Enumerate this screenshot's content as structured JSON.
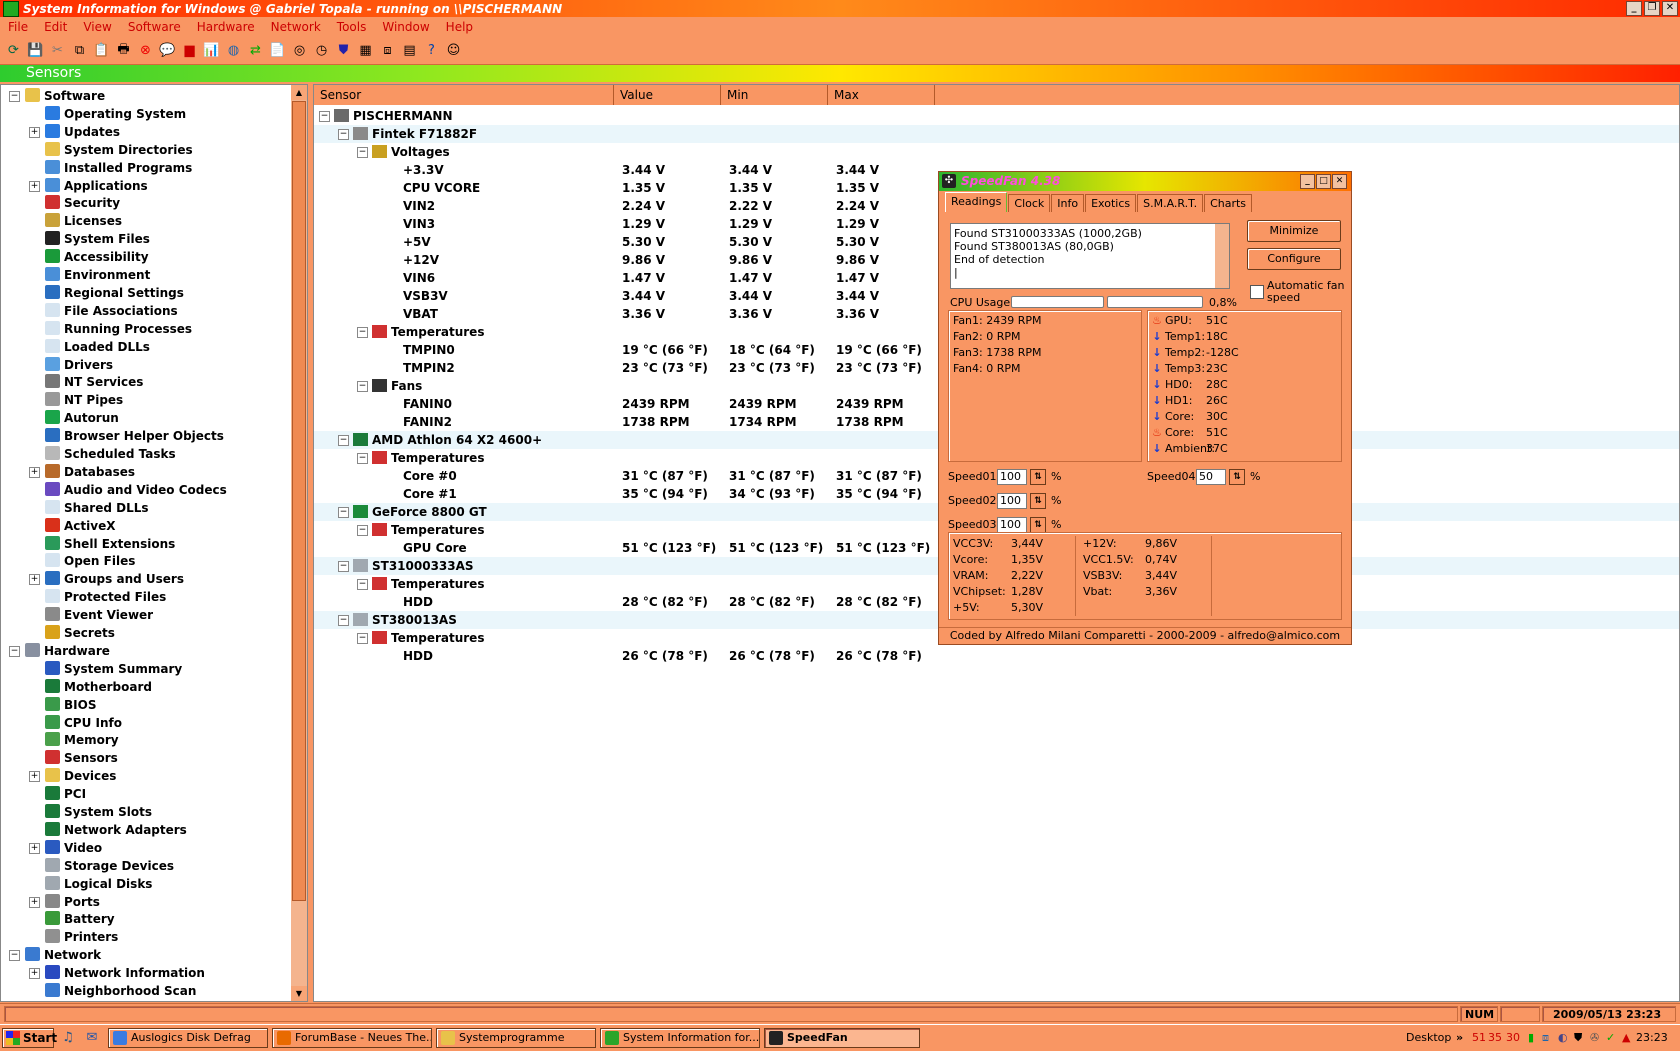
{
  "title": "System Information for Windows  @ Gabriel Topala - running on \\\\PISCHERMANN",
  "menu": [
    "File",
    "Edit",
    "View",
    "Software",
    "Hardware",
    "Network",
    "Tools",
    "Window",
    "Help"
  ],
  "section_header": "Sensors",
  "tree": [
    {
      "label": "Software",
      "level": 0,
      "pm": "−",
      "icon": "folder"
    },
    {
      "label": "Operating System",
      "level": 1,
      "pm": "",
      "icon": "windows"
    },
    {
      "label": "Updates",
      "level": 1,
      "pm": "+",
      "icon": "windows"
    },
    {
      "label": "System Directories",
      "level": 1,
      "pm": "",
      "icon": "folder"
    },
    {
      "label": "Installed Programs",
      "level": 1,
      "pm": "",
      "icon": "window"
    },
    {
      "label": "Applications",
      "level": 1,
      "pm": "+",
      "icon": "window"
    },
    {
      "label": "Security",
      "level": 1,
      "pm": "",
      "icon": "shield"
    },
    {
      "label": "Licenses",
      "level": 1,
      "pm": "",
      "icon": "lock"
    },
    {
      "label": "System Files",
      "level": 1,
      "pm": "",
      "icon": "cmd"
    },
    {
      "label": "Accessibility",
      "level": 1,
      "pm": "",
      "icon": "accessibility"
    },
    {
      "label": "Environment",
      "level": 1,
      "pm": "",
      "icon": "window"
    },
    {
      "label": "Regional Settings",
      "level": 1,
      "pm": "",
      "icon": "globe"
    },
    {
      "label": "File Associations",
      "level": 1,
      "pm": "",
      "icon": "file"
    },
    {
      "label": "Running Processes",
      "level": 1,
      "pm": "",
      "icon": "file"
    },
    {
      "label": "Loaded DLLs",
      "level": 1,
      "pm": "",
      "icon": "file"
    },
    {
      "label": "Drivers",
      "level": 1,
      "pm": "",
      "icon": "star"
    },
    {
      "label": "NT Services",
      "level": 1,
      "pm": "",
      "icon": "gears"
    },
    {
      "label": "NT Pipes",
      "level": 1,
      "pm": "",
      "icon": "pipe"
    },
    {
      "label": "Autorun",
      "level": 1,
      "pm": "",
      "icon": "autorun"
    },
    {
      "label": "Browser Helper Objects",
      "level": 1,
      "pm": "",
      "icon": "globe"
    },
    {
      "label": "Scheduled Tasks",
      "level": 1,
      "pm": "",
      "icon": "clock"
    },
    {
      "label": "Databases",
      "level": 1,
      "pm": "+",
      "icon": "database"
    },
    {
      "label": "Audio and Video Codecs",
      "level": 1,
      "pm": "",
      "icon": "music"
    },
    {
      "label": "Shared DLLs",
      "level": 1,
      "pm": "",
      "icon": "file"
    },
    {
      "label": "ActiveX",
      "level": 1,
      "pm": "",
      "icon": "activex"
    },
    {
      "label": "Shell Extensions",
      "level": 1,
      "pm": "",
      "icon": "shell"
    },
    {
      "label": "Open Files",
      "level": 1,
      "pm": "",
      "icon": "file"
    },
    {
      "label": "Groups and Users",
      "level": 1,
      "pm": "+",
      "icon": "users"
    },
    {
      "label": "Protected Files",
      "level": 1,
      "pm": "",
      "icon": "file"
    },
    {
      "label": "Event Viewer",
      "level": 1,
      "pm": "",
      "icon": "event"
    },
    {
      "label": "Secrets",
      "level": 1,
      "pm": "",
      "icon": "key"
    },
    {
      "label": "Hardware",
      "level": 0,
      "pm": "−",
      "icon": "hardware"
    },
    {
      "label": "System Summary",
      "level": 1,
      "pm": "",
      "icon": "monitor"
    },
    {
      "label": "Motherboard",
      "level": 1,
      "pm": "",
      "icon": "board"
    },
    {
      "label": "BIOS",
      "level": 1,
      "pm": "",
      "icon": "chip"
    },
    {
      "label": "CPU Info",
      "level": 1,
      "pm": "",
      "icon": "chip"
    },
    {
      "label": "Memory",
      "level": 1,
      "pm": "",
      "icon": "memory"
    },
    {
      "label": "Sensors",
      "level": 1,
      "pm": "",
      "icon": "thermo"
    },
    {
      "label": "Devices",
      "level": 1,
      "pm": "+",
      "icon": "devices"
    },
    {
      "label": "PCI",
      "level": 1,
      "pm": "",
      "icon": "board"
    },
    {
      "label": "System Slots",
      "level": 1,
      "pm": "",
      "icon": "board"
    },
    {
      "label": "Network Adapters",
      "level": 1,
      "pm": "",
      "icon": "board"
    },
    {
      "label": "Video",
      "level": 1,
      "pm": "+",
      "icon": "monitor"
    },
    {
      "label": "Storage Devices",
      "level": 1,
      "pm": "",
      "icon": "disk"
    },
    {
      "label": "Logical Disks",
      "level": 1,
      "pm": "",
      "icon": "disk"
    },
    {
      "label": "Ports",
      "level": 1,
      "pm": "+",
      "icon": "port"
    },
    {
      "label": "Battery",
      "level": 1,
      "pm": "",
      "icon": "battery"
    },
    {
      "label": "Printers",
      "level": 1,
      "pm": "",
      "icon": "printer"
    },
    {
      "label": "Network",
      "level": 0,
      "pm": "−",
      "icon": "network"
    },
    {
      "label": "Network Information",
      "level": 1,
      "pm": "+",
      "icon": "info"
    },
    {
      "label": "Neighborhood Scan",
      "level": 1,
      "pm": "",
      "icon": "network"
    }
  ],
  "sensor_columns": [
    "Sensor",
    "Value",
    "Min",
    "Max"
  ],
  "sensor_rows": [
    {
      "indent": 0,
      "label": "PISCHERMANN",
      "pm": "−",
      "icon": "computer",
      "value": "",
      "min": "",
      "max": "",
      "band": false
    },
    {
      "indent": 1,
      "label": "Fintek F71882F",
      "pm": "−",
      "icon": "chipgrey",
      "value": "",
      "min": "",
      "max": "",
      "band": true
    },
    {
      "indent": 2,
      "label": "Voltages",
      "pm": "−",
      "icon": "volt",
      "value": "",
      "min": "",
      "max": "",
      "band": false
    },
    {
      "indent": 3,
      "label": "+3.3V",
      "pm": "",
      "icon": "",
      "value": "3.44 V",
      "min": "3.44 V",
      "max": "3.44 V",
      "band": false
    },
    {
      "indent": 3,
      "label": "CPU VCORE",
      "pm": "",
      "icon": "",
      "value": "1.35 V",
      "min": "1.35 V",
      "max": "1.35 V",
      "band": false
    },
    {
      "indent": 3,
      "label": "VIN2",
      "pm": "",
      "icon": "",
      "value": "2.24 V",
      "min": "2.22 V",
      "max": "2.24 V",
      "band": false
    },
    {
      "indent": 3,
      "label": "VIN3",
      "pm": "",
      "icon": "",
      "value": "1.29 V",
      "min": "1.29 V",
      "max": "1.29 V",
      "band": false
    },
    {
      "indent": 3,
      "label": "+5V",
      "pm": "",
      "icon": "",
      "value": "5.30 V",
      "min": "5.30 V",
      "max": "5.30 V",
      "band": false
    },
    {
      "indent": 3,
      "label": "+12V",
      "pm": "",
      "icon": "",
      "value": "9.86 V",
      "min": "9.86 V",
      "max": "9.86 V",
      "band": false
    },
    {
      "indent": 3,
      "label": "VIN6",
      "pm": "",
      "icon": "",
      "value": "1.47 V",
      "min": "1.47 V",
      "max": "1.47 V",
      "band": false
    },
    {
      "indent": 3,
      "label": "VSB3V",
      "pm": "",
      "icon": "",
      "value": "3.44 V",
      "min": "3.44 V",
      "max": "3.44 V",
      "band": false
    },
    {
      "indent": 3,
      "label": "VBAT",
      "pm": "",
      "icon": "",
      "value": "3.36 V",
      "min": "3.36 V",
      "max": "3.36 V",
      "band": false
    },
    {
      "indent": 2,
      "label": "Temperatures",
      "pm": "−",
      "icon": "thermo",
      "value": "",
      "min": "",
      "max": "",
      "band": false
    },
    {
      "indent": 3,
      "label": "TMPIN0",
      "pm": "",
      "icon": "",
      "value": "19 °C (66 °F)",
      "min": "18 °C (64 °F)",
      "max": "19 °C (66 °F)",
      "band": false
    },
    {
      "indent": 3,
      "label": "TMPIN2",
      "pm": "",
      "icon": "",
      "value": "23 °C (73 °F)",
      "min": "23 °C (73 °F)",
      "max": "23 °C (73 °F)",
      "band": false
    },
    {
      "indent": 2,
      "label": "Fans",
      "pm": "−",
      "icon": "fan",
      "value": "",
      "min": "",
      "max": "",
      "band": false
    },
    {
      "indent": 3,
      "label": "FANIN0",
      "pm": "",
      "icon": "",
      "value": "2439 RPM",
      "min": "2439 RPM",
      "max": "2439 RPM",
      "band": false
    },
    {
      "indent": 3,
      "label": "FANIN2",
      "pm": "",
      "icon": "",
      "value": "1738 RPM",
      "min": "1734 RPM",
      "max": "1738 RPM",
      "band": false
    },
    {
      "indent": 1,
      "label": "AMD Athlon 64 X2 4600+",
      "pm": "−",
      "icon": "cpu",
      "value": "",
      "min": "",
      "max": "",
      "band": true
    },
    {
      "indent": 2,
      "label": "Temperatures",
      "pm": "−",
      "icon": "thermo",
      "value": "",
      "min": "",
      "max": "",
      "band": false
    },
    {
      "indent": 3,
      "label": "Core #0",
      "pm": "",
      "icon": "",
      "value": "31 °C (87 °F)",
      "min": "31 °C (87 °F)",
      "max": "31 °C (87 °F)",
      "band": false
    },
    {
      "indent": 3,
      "label": "Core #1",
      "pm": "",
      "icon": "",
      "value": "35 °C (94 °F)",
      "min": "34 °C (93 °F)",
      "max": "35 °C (94 °F)",
      "band": false
    },
    {
      "indent": 1,
      "label": "GeForce 8800 GT",
      "pm": "−",
      "icon": "gpu",
      "value": "",
      "min": "",
      "max": "",
      "band": true
    },
    {
      "indent": 2,
      "label": "Temperatures",
      "pm": "−",
      "icon": "thermo",
      "value": "",
      "min": "",
      "max": "",
      "band": false
    },
    {
      "indent": 3,
      "label": "GPU Core",
      "pm": "",
      "icon": "",
      "value": "51 °C (123 °F)",
      "min": "51 °C (123 °F)",
      "max": "51 °C (123 °F)",
      "band": false
    },
    {
      "indent": 1,
      "label": "ST31000333AS",
      "pm": "−",
      "icon": "hdd",
      "value": "",
      "min": "",
      "max": "",
      "band": true
    },
    {
      "indent": 2,
      "label": "Temperatures",
      "pm": "−",
      "icon": "thermo",
      "value": "",
      "min": "",
      "max": "",
      "band": false
    },
    {
      "indent": 3,
      "label": "HDD",
      "pm": "",
      "icon": "",
      "value": "28 °C (82 °F)",
      "min": "28 °C (82 °F)",
      "max": "28 °C (82 °F)",
      "band": false
    },
    {
      "indent": 1,
      "label": "ST380013AS",
      "pm": "−",
      "icon": "hdd",
      "value": "",
      "min": "",
      "max": "",
      "band": true
    },
    {
      "indent": 2,
      "label": "Temperatures",
      "pm": "−",
      "icon": "thermo",
      "value": "",
      "min": "",
      "max": "",
      "band": false
    },
    {
      "indent": 3,
      "label": "HDD",
      "pm": "",
      "icon": "",
      "value": "26 °C (78 °F)",
      "min": "26 °C (78 °F)",
      "max": "26 °C (78 °F)",
      "band": false
    }
  ],
  "speedfan": {
    "title": "SpeedFan 4.38",
    "tabs": [
      "Readings",
      "Clock",
      "Info",
      "Exotics",
      "S.M.A.R.T.",
      "Charts"
    ],
    "active_tab": "Readings",
    "log": [
      "Found ST31000333AS (1000,2GB)",
      "Found ST380013AS (80,0GB)",
      "End of detection",
      "|"
    ],
    "minimize_label": "Minimize",
    "configure_label": "Configure",
    "auto_fan_label": "Automatic fan speed",
    "cpu_usage_label": "CPU Usage",
    "cpu_usage_value": "0,8%",
    "fans": [
      "Fan1: 2439 RPM",
      "Fan2: 0 RPM",
      "Fan3: 1738 RPM",
      "Fan4: 0 RPM"
    ],
    "temps": [
      {
        "name": "GPU:",
        "value": "51C",
        "trend": "hot"
      },
      {
        "name": "Temp1:",
        "value": "18C",
        "trend": "down"
      },
      {
        "name": "Temp2:",
        "value": "-128C",
        "trend": "down"
      },
      {
        "name": "Temp3:",
        "value": "23C",
        "trend": "down"
      },
      {
        "name": "HD0:",
        "value": "28C",
        "trend": "down"
      },
      {
        "name": "HD1:",
        "value": "26C",
        "trend": "down"
      },
      {
        "name": "Core:",
        "value": "30C",
        "trend": "down"
      },
      {
        "name": "Core:",
        "value": "51C",
        "trend": "hot"
      },
      {
        "name": "Ambient:",
        "value": "37C",
        "trend": "down"
      }
    ],
    "speeds": [
      {
        "label": "Speed01:",
        "value": "100"
      },
      {
        "label": "Speed02:",
        "value": "100"
      },
      {
        "label": "Speed03:",
        "value": "100"
      },
      {
        "label": "Speed04:",
        "value": "50"
      }
    ],
    "percent_sign": "%",
    "volts_left": [
      {
        "name": "VCC3V:",
        "value": "3,44V"
      },
      {
        "name": "Vcore:",
        "value": "1,35V"
      },
      {
        "name": "VRAM:",
        "value": "2,22V"
      },
      {
        "name": "VChipset:",
        "value": "1,28V"
      },
      {
        "name": "+5V:",
        "value": "5,30V"
      }
    ],
    "volts_right": [
      {
        "name": "+12V:",
        "value": "9,86V"
      },
      {
        "name": "VCC1.5V:",
        "value": "0,74V"
      },
      {
        "name": "VSB3V:",
        "value": "3,44V"
      },
      {
        "name": "Vbat:",
        "value": "3,36V"
      }
    ],
    "footer": "Coded by Alfredo Milani Comparetti - 2000-2009 - alfredo@almico.com"
  },
  "status": {
    "num": "NUM",
    "datetime": "2009/05/13 23:23"
  },
  "taskbar": {
    "start_label": "Start",
    "tasks": [
      {
        "label": "Auslogics Disk Defrag",
        "active": false,
        "color": "#3a7be0"
      },
      {
        "label": "ForumBase - Neues The...",
        "active": false,
        "color": "#e86a00"
      },
      {
        "label": "Systemprogramme",
        "active": false,
        "color": "#e8c24a"
      },
      {
        "label": "System Information for...",
        "active": false,
        "color": "#2aa52a"
      },
      {
        "label": "SpeedFan",
        "active": true,
        "color": "#222222"
      }
    ],
    "desktop_label": "Desktop",
    "tray_temps": [
      "51",
      "35",
      "30"
    ],
    "clock": "23:23"
  }
}
